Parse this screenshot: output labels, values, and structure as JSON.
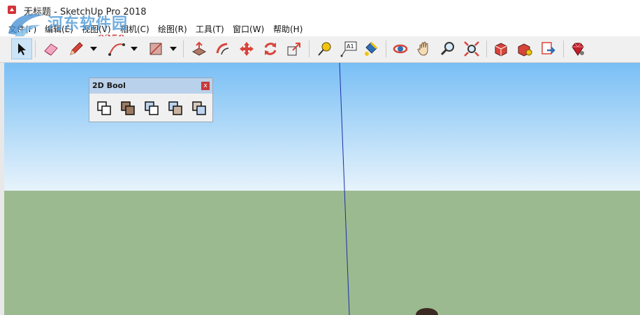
{
  "window": {
    "title": "无标题 - SketchUp Pro 2018"
  },
  "watermark": {
    "site_name": "河东软件园",
    "url": "www.pc0359.cn"
  },
  "menu": {
    "items": [
      "文件(F)",
      "编辑(E)",
      "视图(V)",
      "相机(C)",
      "绘图(R)",
      "工具(T)",
      "窗口(W)",
      "帮助(H)"
    ]
  },
  "toolbar": {
    "tools": [
      {
        "name": "select",
        "icon": "arrow-cursor-icon",
        "active": true
      },
      {
        "name": "eraser",
        "icon": "eraser-icon"
      },
      {
        "name": "line",
        "icon": "pencil-icon"
      },
      {
        "name": "arc",
        "icon": "arc-icon"
      },
      {
        "name": "shapes",
        "icon": "rectangle-icon"
      },
      {
        "name": "push-pull",
        "icon": "push-pull-icon"
      },
      {
        "name": "offset",
        "icon": "offset-icon"
      },
      {
        "name": "move",
        "icon": "move-icon"
      },
      {
        "name": "rotate",
        "icon": "rotate-icon"
      },
      {
        "name": "scale",
        "icon": "scale-icon"
      },
      {
        "name": "tape-measure",
        "icon": "tape-measure-icon"
      },
      {
        "name": "text",
        "icon": "text-label-icon"
      },
      {
        "name": "paint-bucket",
        "icon": "paint-bucket-icon"
      },
      {
        "name": "orbit",
        "icon": "orbit-icon"
      },
      {
        "name": "pan",
        "icon": "hand-icon"
      },
      {
        "name": "zoom",
        "icon": "zoom-icon"
      },
      {
        "name": "zoom-extents",
        "icon": "zoom-extents-icon"
      },
      {
        "name": "3d-warehouse",
        "icon": "warehouse-icon"
      },
      {
        "name": "extension-warehouse",
        "icon": "extension-warehouse-icon"
      },
      {
        "name": "send-to-layout",
        "icon": "send-to-layout-icon"
      },
      {
        "name": "extension-manager",
        "icon": "ruby-gem-icon"
      }
    ],
    "text_icon_label": "A1"
  },
  "panel_2d_bool": {
    "title": "2D Bool",
    "close_label": "x",
    "buttons": [
      "union-icon",
      "intersect-icon",
      "subtract-icon",
      "trim-icon",
      "split-icon"
    ]
  },
  "colors": {
    "sky_top": "#79bff5",
    "sky_bottom": "#e7f3fb",
    "ground": "#9cba8f",
    "axis_blue": "#1a2fa8",
    "panel_title_bg": "#b9d1ea",
    "close_button": "#c83a3a"
  }
}
